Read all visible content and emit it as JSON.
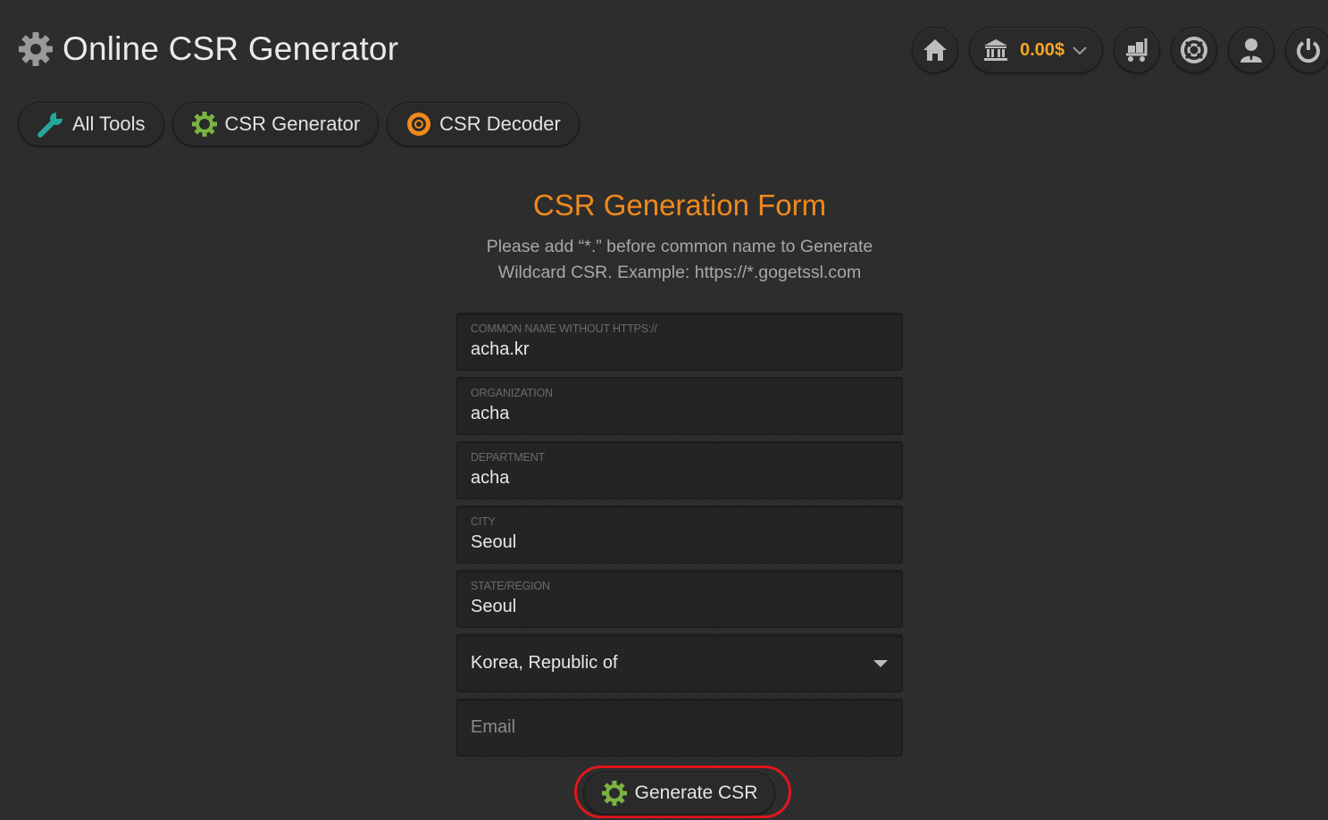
{
  "header": {
    "title": "Online CSR Generator",
    "title_icon": "gear-icon"
  },
  "top_actions": {
    "home_icon": "home-icon",
    "balance_icon": "bank-icon",
    "balance": "0.00$",
    "balance_dropdown_icon": "chevron-down-icon",
    "cart_icon": "cart-icon",
    "support_icon": "lifebuoy-icon",
    "account_icon": "user-icon",
    "logout_icon": "power-icon"
  },
  "tabs": [
    {
      "label": "All Tools",
      "icon": "wrench-icon"
    },
    {
      "label": "CSR Generator",
      "icon": "gear-icon"
    },
    {
      "label": "CSR Decoder",
      "icon": "gear-icon"
    }
  ],
  "form": {
    "heading": "CSR Generation Form",
    "subtext": "Please add “*.” before common name to Generate Wildcard CSR. Example: https://*.gogetssl.com",
    "fields": [
      {
        "label": "COMMON NAME WITHOUT HTTPS://",
        "value": "acha.kr"
      },
      {
        "label": "ORGANIZATION",
        "value": "acha"
      },
      {
        "label": "DEPARTMENT",
        "value": "acha"
      },
      {
        "label": "CITY",
        "value": "Seoul"
      },
      {
        "label": "STATE/REGION",
        "value": "Seoul"
      }
    ],
    "country": {
      "selected": "Korea, Republic of"
    },
    "email": {
      "placeholder": "Email",
      "value": ""
    },
    "submit_label": "Generate CSR"
  },
  "colors": {
    "accent": "#ee8a1d",
    "balance": "#f5a623",
    "gear_green": "#7cb342",
    "wrench_teal": "#26a69a",
    "highlight": "#e0161c"
  }
}
